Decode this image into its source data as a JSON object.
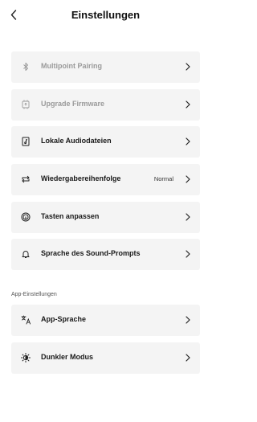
{
  "header": {
    "title": "Einstellungen",
    "back_icon": "chevron-left-icon"
  },
  "items": [
    {
      "label": "Multipoint Pairing",
      "icon": "bluetooth-icon",
      "disabled": true
    },
    {
      "label": "Upgrade Firmware",
      "icon": "firmware-chip-icon",
      "disabled": true
    },
    {
      "label": "Lokale Audiodateien",
      "icon": "music-file-icon",
      "disabled": false
    },
    {
      "label": "Wiedergabereihenfolge",
      "value": "Normal",
      "icon": "repeat-icon",
      "disabled": false
    },
    {
      "label": "Tasten anpassen",
      "icon": "touch-icon",
      "disabled": false
    },
    {
      "label": "Sprache des Sound-Prompts",
      "icon": "bell-icon",
      "disabled": false
    }
  ],
  "app_section": {
    "title": "App-Einstellungen",
    "items": [
      {
        "label": "App-Sprache",
        "icon": "translate-icon"
      },
      {
        "label": "Dunkler Modus",
        "icon": "sun-moon-icon"
      }
    ]
  },
  "colors": {
    "card_bg": "#f4f4f4",
    "disabled_text": "#9a9a9a",
    "text": "#1a1a1a"
  }
}
